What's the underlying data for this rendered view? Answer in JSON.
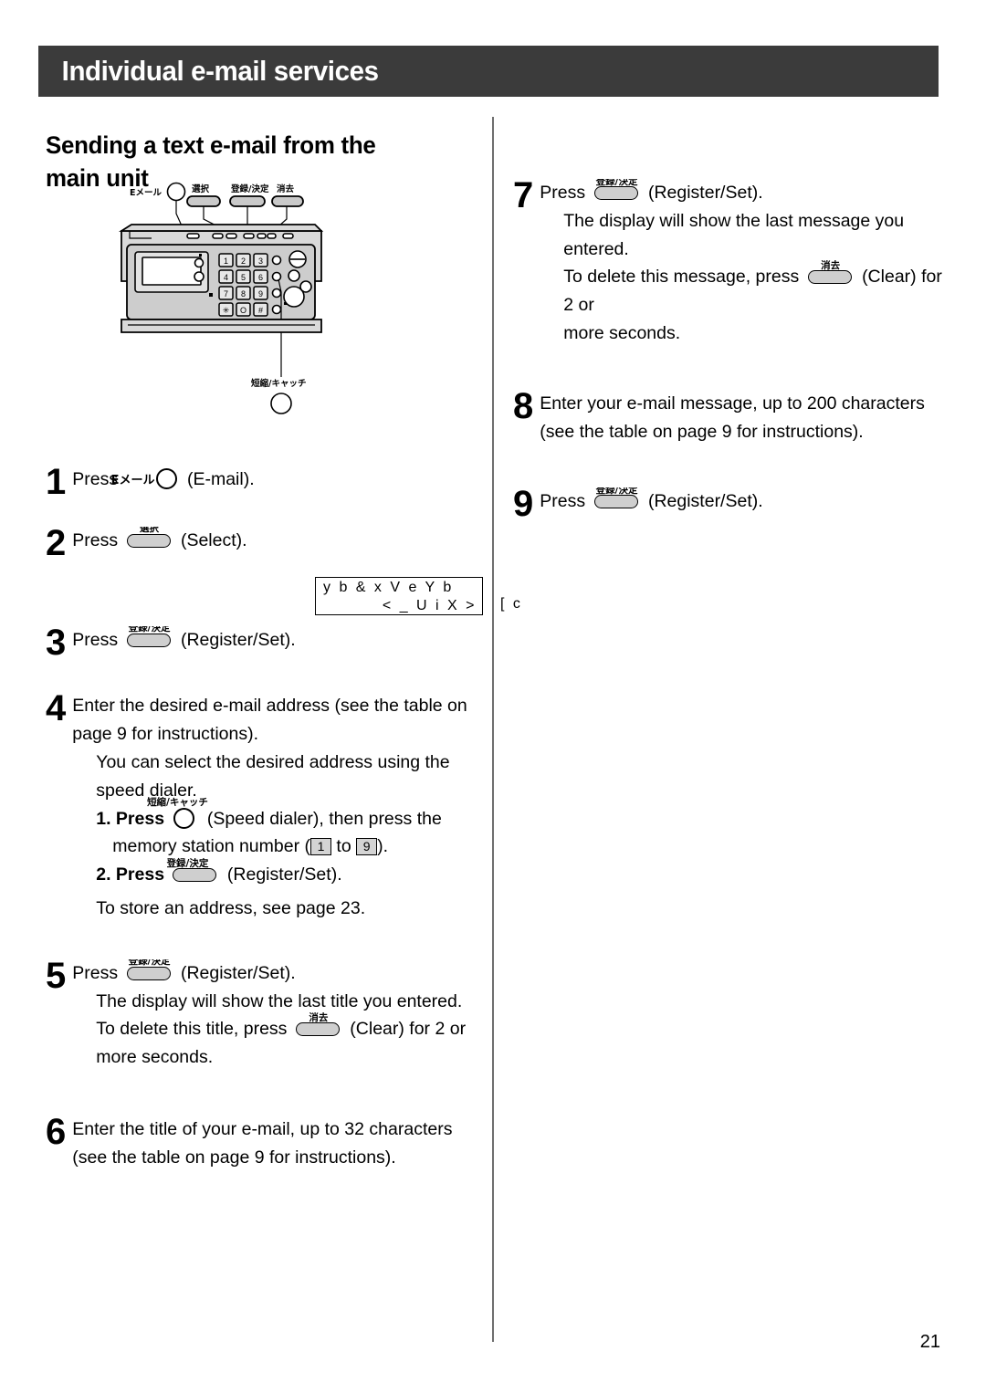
{
  "header": {
    "title": "Individual e-mail services"
  },
  "section": {
    "heading": "Sending a text e-mail from the main unit"
  },
  "buttons": {
    "email_jp": "Eメール",
    "email_en": "E-mail",
    "select_jp": "選択",
    "select_en": "Select",
    "register_jp": "登録/決定",
    "register_en": "Register/Set",
    "clear_jp": "消去",
    "clear_en": "Clear",
    "speed_dialer_jp": "短縮/キャッチ",
    "speed_dialer_en": "Speed dialer"
  },
  "figure": {
    "label_email": "Eメール",
    "label_select": "選択",
    "label_register": "登録/決定",
    "label_clear": "消去",
    "label_speed_dialer": "短縮/キャッチ",
    "keypad": [
      "1",
      "2",
      "3",
      "4",
      "5",
      "6",
      "7",
      "8",
      "9",
      "✳",
      "O",
      "#"
    ]
  },
  "lcd_sample": {
    "line1": "y b  & x V e Y b",
    "line2": "< _ U i X >",
    "overflow": "[ c"
  },
  "steps_left": [
    {
      "num": "1",
      "prefix": "Press",
      "glyph": "email-circle",
      "suffix": "(E-mail)."
    },
    {
      "num": "2",
      "prefix": "Press",
      "glyph": "select-pill",
      "suffix": "(Select)."
    },
    {
      "num": "3",
      "prefix": "Press",
      "glyph": "register-pill",
      "suffix": "(Register/Set)."
    },
    {
      "num": "4",
      "main": "Enter the desired e-mail address (see the table on page 9 for instructions).",
      "note": "You can select the desired address using the speed dialer.",
      "sub1_a": "1. Press",
      "sub1_b": "(Speed dialer), then press the",
      "sub1_c": "memory station number (",
      "sub1_key_from": "1",
      "sub1_to": "to",
      "sub1_key_to": "9",
      "sub1_d": ").",
      "sub2_a": "2. Press",
      "sub2_b": "(Register/Set).",
      "footer": "To store an address, see page 23."
    },
    {
      "num": "5",
      "prefix": "Press",
      "glyph": "register-pill",
      "suffix": "(Register/Set).",
      "note": "The display will show the last title you entered.",
      "delete_a": "To delete this title, press",
      "delete_b": "(Clear) for 2 or more seconds."
    },
    {
      "num": "6",
      "main": "Enter the title of your e-mail, up to 32 characters (see the table on page 9 for instructions)."
    }
  ],
  "steps_right": [
    {
      "num": "7",
      "prefix": "Press",
      "glyph": "register-pill",
      "suffix": "(Register/Set).",
      "note": "The display will show the last message you entered.",
      "delete_a": "To delete this message, press",
      "delete_b": "(Clear) for 2 or",
      "delete_c": "more seconds."
    },
    {
      "num": "8",
      "main": "Enter your e-mail message, up to 200 characters (see the table on page 9 for instructions)."
    },
    {
      "num": "9",
      "prefix": "Press",
      "glyph": "register-pill",
      "suffix": "(Register/Set)."
    }
  ],
  "page_number": "21",
  "colors": {
    "banner_bg": "#3b3b3b",
    "banner_text": "#ffffff",
    "button_fill": "#cfcfcf",
    "divider": "#6e6e6e"
  }
}
